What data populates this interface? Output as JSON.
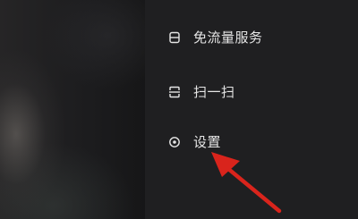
{
  "menu": {
    "items": [
      {
        "label": "免流量服务",
        "icon": "card-icon"
      },
      {
        "label": "扫一扫",
        "icon": "scan-icon"
      },
      {
        "label": "设置",
        "icon": "settings-icon"
      }
    ]
  },
  "annotation": {
    "arrow_color": "#d9241c"
  },
  "colors": {
    "panel_background": "#1f1f21",
    "text": "#e6e6e6"
  }
}
